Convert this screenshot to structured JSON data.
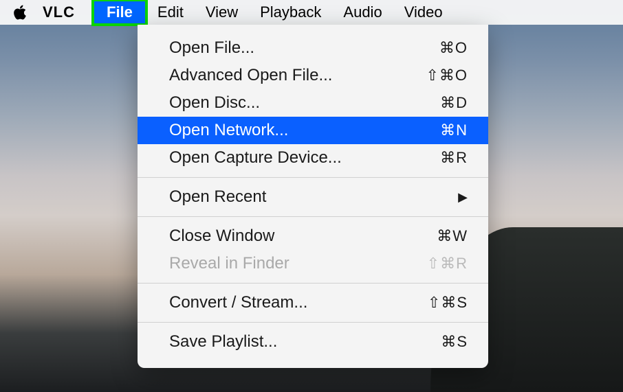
{
  "menubar": {
    "app_name": "VLC",
    "items": [
      {
        "label": "File",
        "highlighted": true
      },
      {
        "label": "Edit"
      },
      {
        "label": "View"
      },
      {
        "label": "Playback"
      },
      {
        "label": "Audio"
      },
      {
        "label": "Video"
      }
    ]
  },
  "dropdown": {
    "items": [
      {
        "label": "Open File...",
        "shortcut": "⌘O"
      },
      {
        "label": "Advanced Open File...",
        "shortcut": "⇧⌘O"
      },
      {
        "label": "Open Disc...",
        "shortcut": "⌘D"
      },
      {
        "label": "Open Network...",
        "shortcut": "⌘N",
        "selected": true
      },
      {
        "label": "Open Capture Device...",
        "shortcut": "⌘R"
      },
      {
        "separator": true
      },
      {
        "label": "Open Recent",
        "submenu": true
      },
      {
        "separator": true
      },
      {
        "label": "Close Window",
        "shortcut": "⌘W"
      },
      {
        "label": "Reveal in Finder",
        "shortcut": "⇧⌘R",
        "disabled": true
      },
      {
        "separator": true
      },
      {
        "label": "Convert / Stream...",
        "shortcut": "⇧⌘S"
      },
      {
        "separator": true
      },
      {
        "label": "Save Playlist...",
        "shortcut": "⌘S"
      }
    ]
  }
}
